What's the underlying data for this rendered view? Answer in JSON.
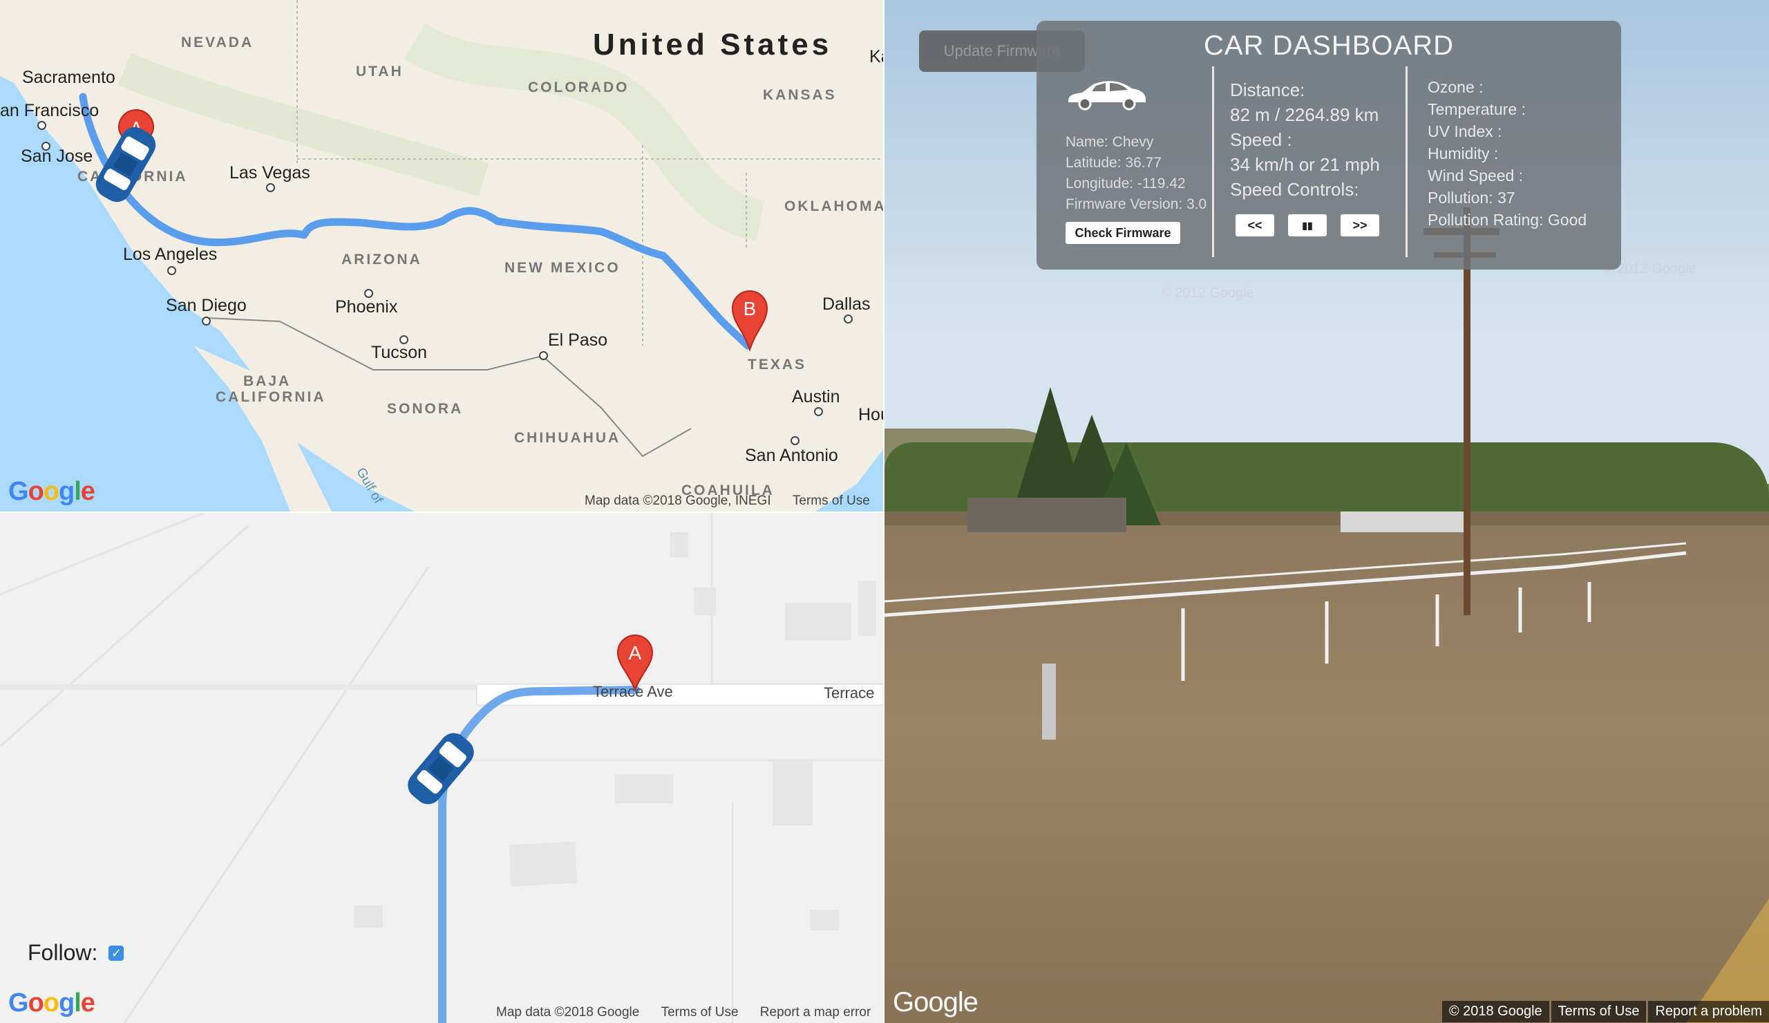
{
  "map_top": {
    "country": "United States",
    "states": [
      "NEVADA",
      "UTAH",
      "COLORADO",
      "KANSAS",
      "OKLAHOMA",
      "ARIZONA",
      "NEW MEXICO",
      "TEXAS",
      "BAJA",
      "CALIFORNIA",
      "SONORA",
      "CHIHUAHUA",
      "COAHUILA",
      "CALIFORNIA"
    ],
    "cities": [
      "Sacramento",
      "an Francisco",
      "San Jose",
      "Las Vegas",
      "Los Angeles",
      "San Diego",
      "Phoenix",
      "Tucson",
      "El Paso",
      "Dallas",
      "Austin",
      "San Antonio",
      "Hou",
      "Ka"
    ],
    "gulf_label": "Gulf of",
    "marker_a": "A",
    "marker_b": "B",
    "attribution": {
      "data": "Map data ©2018 Google, INEGI",
      "terms": "Terms of Use"
    },
    "logo": "Google"
  },
  "map_bottom": {
    "road_labels": [
      "Terrace Ave",
      "Terrace"
    ],
    "marker_a": "A",
    "follow_label": "Follow:",
    "follow_checked": true,
    "attribution": {
      "data": "Map data ©2018 Google",
      "terms": "Terms of Use",
      "report": "Report a map error"
    },
    "logo": "Google"
  },
  "street_view": {
    "logo": "Google",
    "watermarks": [
      "© 2012 Google",
      "© 2012 Google"
    ],
    "attribution": {
      "copyright": "© 2018 Google",
      "terms": "Terms of Use",
      "report": "Report a problem"
    }
  },
  "dashboard": {
    "update_firmware_label": "Update Firmware",
    "title": "CAR DASHBOARD",
    "car": {
      "name": "Name: Chevy",
      "latitude": "Latitude: 36.77",
      "longitude": "Longitude: -119.42",
      "firmware": "Firmware Version: 3.0",
      "check_firmware_label": "Check Firmware"
    },
    "trip": {
      "distance_label": "Distance:",
      "distance_value": "82 m / 2264.89 km",
      "speed_label": "Speed :",
      "speed_value": "34 km/h or 21 mph",
      "speed_controls_label": "Speed Controls:",
      "rewind_label": "<<",
      "pause_label": "▮▮",
      "forward_label": ">>"
    },
    "environment": {
      "ozone": "Ozone :",
      "temperature": "Temperature :",
      "uv_index": "UV Index :",
      "humidity": "Humidity :",
      "wind_speed": "Wind Speed :",
      "pollution": "Pollution: 37",
      "pollution_rating": "Pollution Rating: Good"
    }
  },
  "colors": {
    "route": "#5a9ded",
    "marker": "#ea4335",
    "car": "#1e5fa8",
    "map_land": "#f3eee3",
    "water": "#aadaff"
  }
}
